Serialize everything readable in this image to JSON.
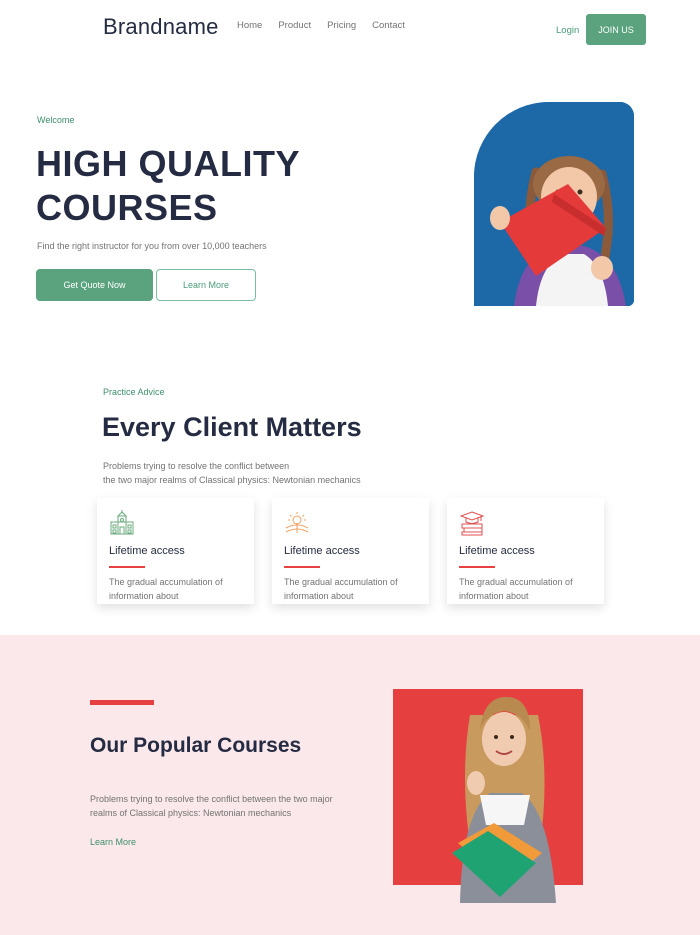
{
  "nav": {
    "brand": "Brandname",
    "links": [
      "Home",
      "Product",
      "Pricing",
      "Contact"
    ],
    "login": "Login",
    "join": "JOIN US"
  },
  "hero": {
    "eyebrow": "Welcome",
    "title_line1": "HIGH QUALITY",
    "title_line2": "COURSES",
    "subtitle": "Find the right instructor for you from over 10,000 teachers",
    "primary_button": "Get Quote Now",
    "secondary_button": "Learn More"
  },
  "practice": {
    "eyebrow": "Practice Advice",
    "title": "Every Client Matters",
    "subtitle_line1": "Problems trying to resolve the conflict between",
    "subtitle_line2": "the two major realms of Classical physics: Newtonian mechanics",
    "cards": [
      {
        "icon": "school-building-icon",
        "title": "Lifetime access",
        "text_line1": "The gradual accumulation of",
        "text_line2": "information about"
      },
      {
        "icon": "sunrise-book-icon",
        "title": "Lifetime access",
        "text_line1": "The gradual accumulation of",
        "text_line2": "information about"
      },
      {
        "icon": "graduation-books-icon",
        "title": "Lifetime access",
        "text_line1": "The gradual accumulation of",
        "text_line2": "information about"
      }
    ]
  },
  "courses": {
    "title": "Our Popular Courses",
    "subtitle_line1": "Problems trying to resolve the conflict between the two major",
    "subtitle_line2": "realms of Classical physics: Newtonian mechanics",
    "link": "Learn More"
  },
  "colors": {
    "accent_green": "#5aa37e",
    "accent_red": "#e74040",
    "hero_blue": "#1d69a8",
    "courses_bg": "#fae8ea"
  }
}
